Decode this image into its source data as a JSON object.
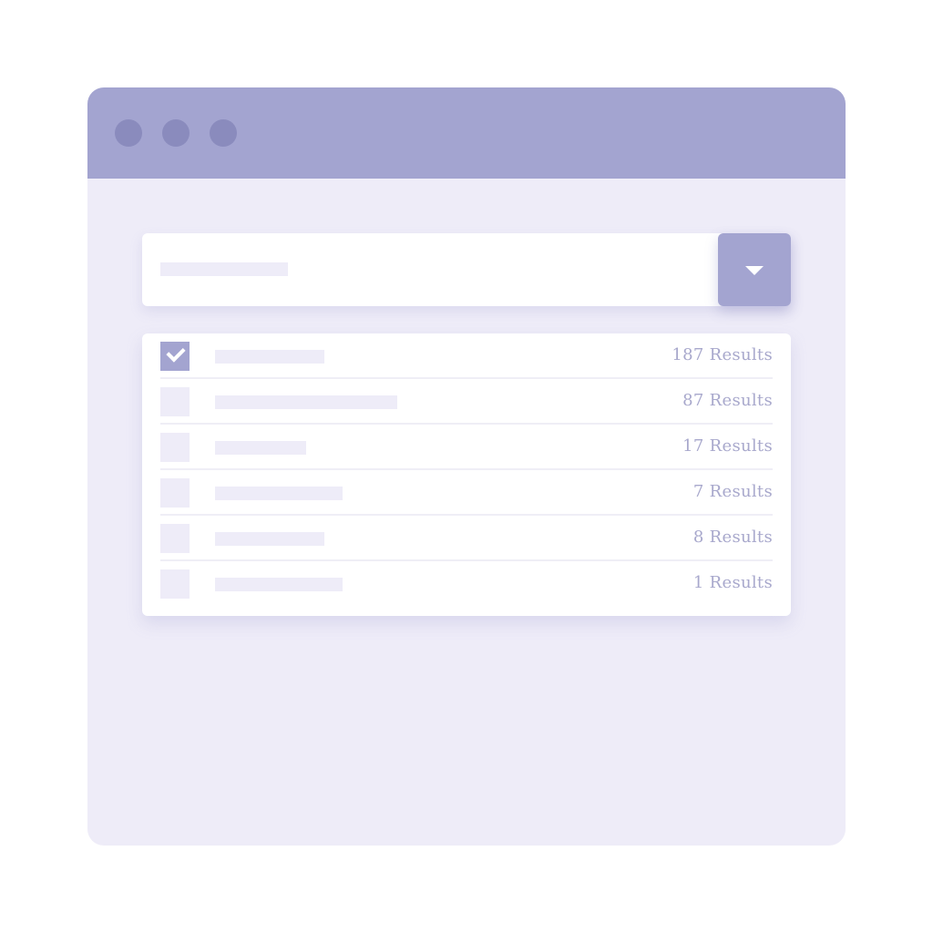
{
  "colors": {
    "titlebar": "#a3a4d0",
    "window_body": "#eeecf8",
    "traffic_dot": "#8a8bbd",
    "accent": "#a3a4d0",
    "placeholder": "#eeecf8",
    "text_muted": "#a8a8cc"
  },
  "dropdown": {
    "icon": "caret-down-icon"
  },
  "results": {
    "items": [
      {
        "checked": true,
        "count_label": "187 Results"
      },
      {
        "checked": false,
        "count_label": "87 Results"
      },
      {
        "checked": false,
        "count_label": "17 Results"
      },
      {
        "checked": false,
        "count_label": "7 Results"
      },
      {
        "checked": false,
        "count_label": "8 Results"
      },
      {
        "checked": false,
        "count_label": "1 Results"
      }
    ]
  }
}
